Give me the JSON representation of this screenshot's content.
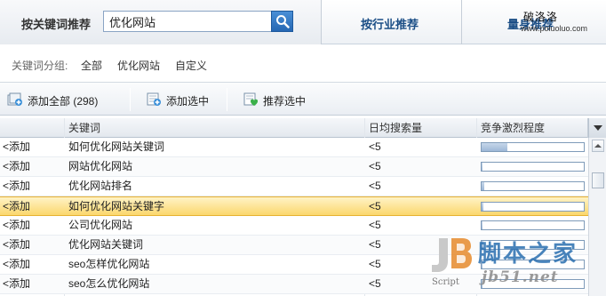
{
  "tabs": {
    "keyword_tab_label": "按关键词推荐",
    "industry_tab_label": "按行业推荐",
    "custom_tab_label": "量身推荐"
  },
  "search": {
    "value": "优化网站",
    "button_icon": "search-icon"
  },
  "groups": {
    "label": "关键词分组:",
    "items": [
      "全部",
      "优化网站",
      "自定义"
    ]
  },
  "toolbar": {
    "add_all_label": "添加全部 (298)",
    "add_selected_label": "添加选中",
    "recommend_selected_label": "推荐选中"
  },
  "grid": {
    "headers": [
      "关键词",
      "日均搜索量",
      "竞争激烈程度"
    ],
    "rows": [
      {
        "action": "<添加",
        "keyword": "如何优化网站关键词",
        "volume": "<5",
        "competition": 0.25
      },
      {
        "action": "<添加",
        "keyword": "网站优化网站",
        "volume": "<5",
        "competition": 0.01
      },
      {
        "action": "<添加",
        "keyword": "优化网站排名",
        "volume": "<5",
        "competition": 0.03
      },
      {
        "action": "<添加",
        "keyword": "如何优化网站关键字",
        "volume": "<5",
        "competition": 0.02
      },
      {
        "action": "<添加",
        "keyword": "公司优化网站",
        "volume": "<5",
        "competition": 0.01
      },
      {
        "action": "<添加",
        "keyword": "优化网站关键词",
        "volume": "<5",
        "competition": 0.02
      },
      {
        "action": "<添加",
        "keyword": "seo怎样优化网站",
        "volume": "<5",
        "competition": 0.01
      },
      {
        "action": "<添加",
        "keyword": "seo怎么优化网站",
        "volume": "<5",
        "competition": 0.01
      }
    ],
    "selected_row": 3
  },
  "watermarks": {
    "top_title": "破洛洛",
    "top_url": "www.poluoluo.com",
    "bottom_cn": "脚本之家",
    "bottom_url": "jb51.net",
    "bottom_script": "Script"
  },
  "colors": {
    "accent": "#2567b3",
    "selected_row": "#fbd76d",
    "link": "#1b4e86"
  }
}
